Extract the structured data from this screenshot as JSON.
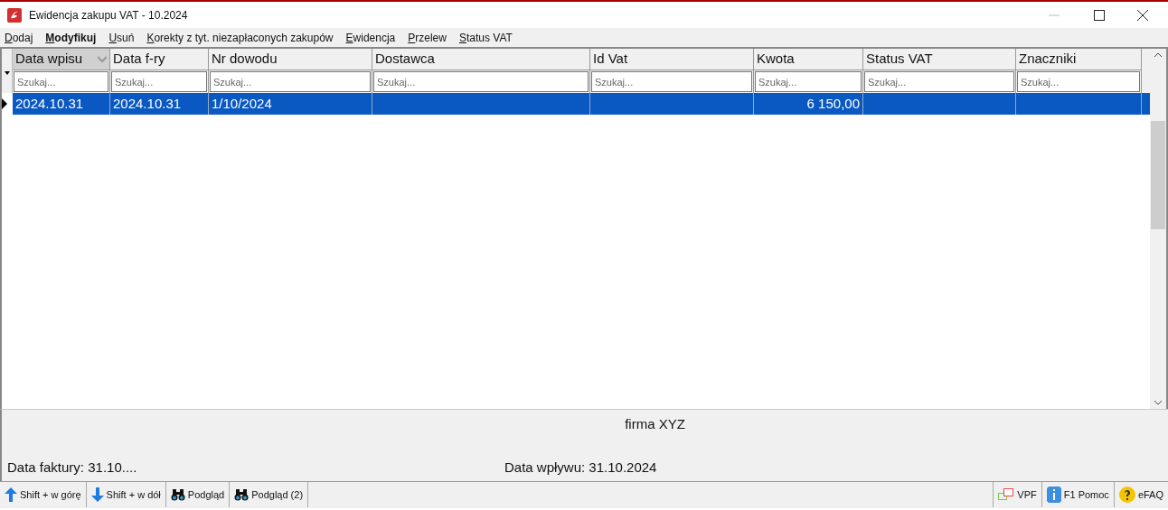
{
  "window": {
    "title": "Ewidencja zakupu VAT - 10.2024"
  },
  "menu": [
    {
      "label": "Dodaj",
      "bold": false
    },
    {
      "label": "Modyfikuj",
      "bold": true
    },
    {
      "label": "Usuń",
      "bold": false
    },
    {
      "label": "Korekty z tyt. niezapłaconych zakupów",
      "bold": false
    },
    {
      "label": "Ewidencja",
      "bold": false
    },
    {
      "label": "Przelew",
      "bold": false
    },
    {
      "label": "Status VAT",
      "bold": false
    }
  ],
  "table": {
    "columns": [
      {
        "label": "Data wpisu",
        "sorted": true,
        "placeholder": "Szukaj..."
      },
      {
        "label": "Data f-ry",
        "sorted": false,
        "placeholder": "Szukaj..."
      },
      {
        "label": "Nr dowodu",
        "sorted": false,
        "placeholder": "Szukaj..."
      },
      {
        "label": "Dostawca",
        "sorted": false,
        "placeholder": "Szukaj..."
      },
      {
        "label": "Id Vat",
        "sorted": false,
        "placeholder": "Szukaj..."
      },
      {
        "label": "Kwota",
        "sorted": false,
        "placeholder": "Szukaj..."
      },
      {
        "label": "Status VAT",
        "sorted": false,
        "placeholder": "Szukaj..."
      },
      {
        "label": "Znaczniki",
        "sorted": false,
        "placeholder": "Szukaj..."
      }
    ],
    "rows": [
      {
        "selected": true,
        "cells": [
          "2024.10.31",
          "2024.10.31",
          "1/10/2024",
          "",
          "",
          "6 150,00",
          "",
          ""
        ]
      }
    ]
  },
  "info": {
    "company": "firma XYZ",
    "invoice_date": "Data faktury: 31.10....",
    "receipt_date": "Data wpływu: 31.10.2024"
  },
  "toolbar_left": [
    {
      "kind": "up",
      "label": "Shift + w górę"
    },
    {
      "kind": "down",
      "label": "Shift + w dół"
    },
    {
      "kind": "binoculars",
      "label": "Podgląd"
    },
    {
      "kind": "binoculars",
      "label": "Podgląd (2)"
    }
  ],
  "toolbar_right": [
    {
      "kind": "vpf",
      "label": "VPF"
    },
    {
      "kind": "info",
      "label": "F1 Pomoc"
    },
    {
      "kind": "question",
      "label": "eFAQ"
    }
  ]
}
